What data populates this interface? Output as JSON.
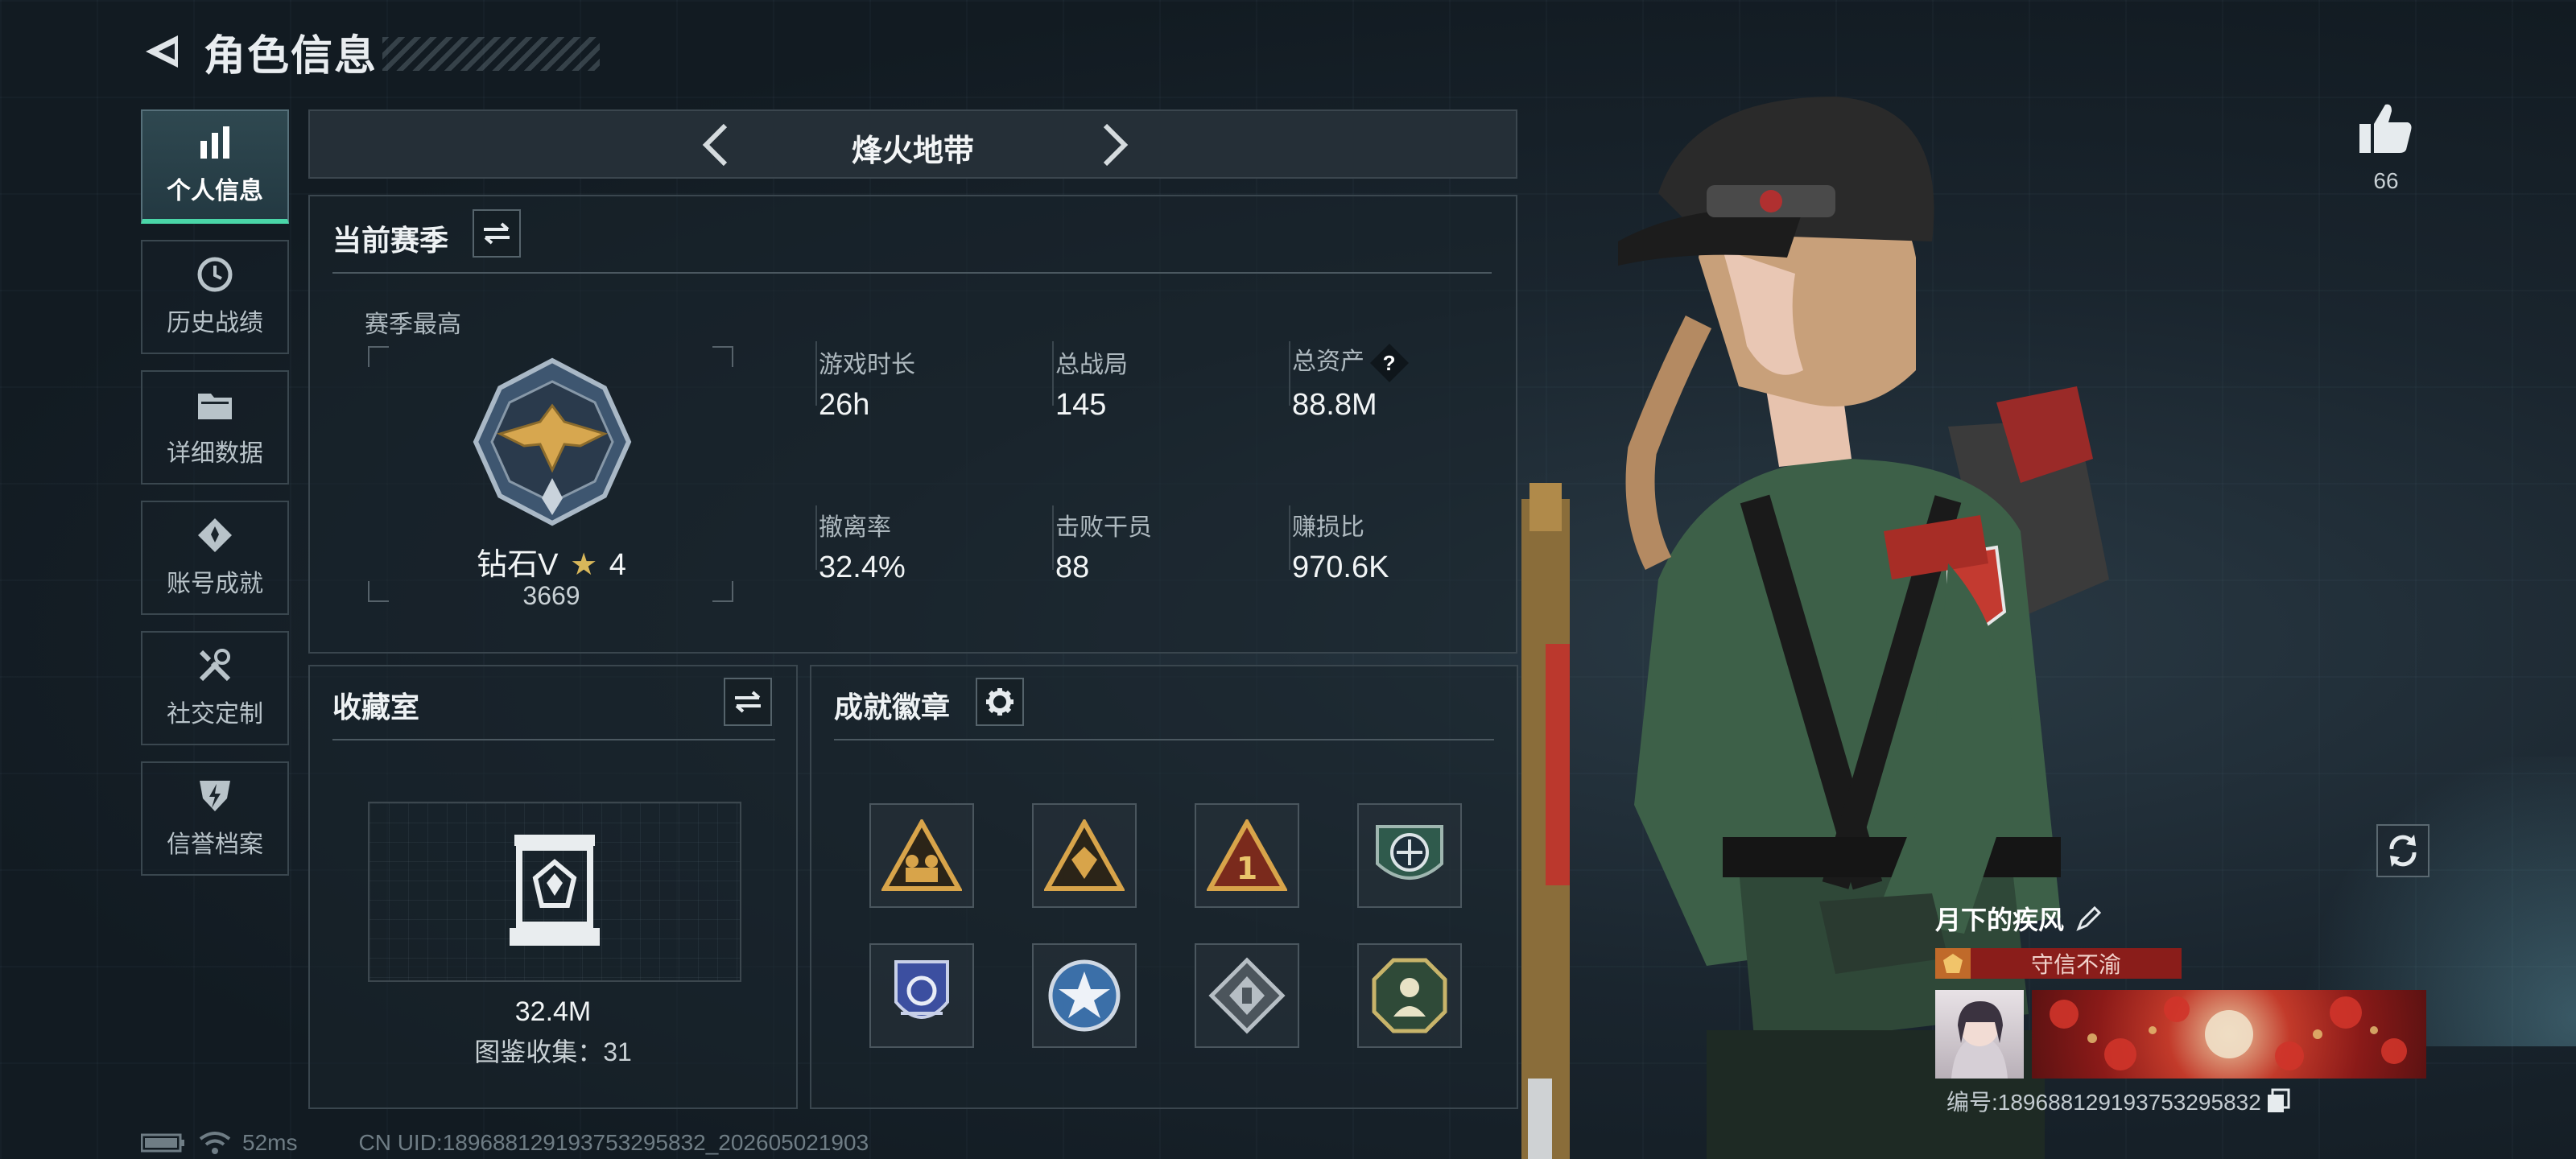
{
  "header": {
    "title": "角色信息"
  },
  "tabs": [
    {
      "label": "个人信息",
      "icon": "bar-chart-icon",
      "active": true
    },
    {
      "label": "历史战绩",
      "icon": "history-icon",
      "active": false
    },
    {
      "label": "详细数据",
      "icon": "folder-icon",
      "active": false
    },
    {
      "label": "账号成就",
      "icon": "achievement-icon",
      "active": false
    },
    {
      "label": "社交定制",
      "icon": "tools-icon",
      "active": false
    },
    {
      "label": "信誉档案",
      "icon": "shield-bolt-icon",
      "active": false
    }
  ],
  "mode": {
    "name": "烽火地带"
  },
  "season": {
    "title": "当前赛季",
    "best_label": "赛季最高",
    "rank_name": "钻石V",
    "rank_stars": "4",
    "rank_score": "3669",
    "stats": [
      {
        "label": "游戏时长",
        "value": "26h"
      },
      {
        "label": "总战局",
        "value": "145"
      },
      {
        "label": "总资产",
        "value": "88.8M",
        "help": "?"
      },
      {
        "label": "撤离率",
        "value": "32.4%"
      },
      {
        "label": "击败干员",
        "value": "88"
      },
      {
        "label": "赚损比",
        "value": "970.6K"
      }
    ]
  },
  "collection": {
    "title": "收藏室",
    "value": "32.4M",
    "codex_label": "图鉴收集：31"
  },
  "badges": {
    "title": "成就徽章",
    "items": [
      {
        "icon": "triangle-soldiers-badge-icon",
        "color": "#d8a44a"
      },
      {
        "icon": "triangle-crest-badge-icon",
        "color": "#d8a44a"
      },
      {
        "icon": "triangle-number-one-badge-icon",
        "color": "#c0452c"
      },
      {
        "icon": "green-circle-emblem-badge-icon",
        "color": "#3a6a5a"
      },
      {
        "icon": "blue-shield-badge-icon",
        "color": "#3c4fa0"
      },
      {
        "icon": "star-circle-badge-icon",
        "color": "#3b6fa8"
      },
      {
        "icon": "silver-diamond-badge-icon",
        "color": "#b6bec4"
      },
      {
        "icon": "green-octagon-badge-icon",
        "color": "#4b7a58"
      }
    ]
  },
  "profile": {
    "likes": "66",
    "name": "月下的疾风",
    "honor_title": "守信不渝",
    "id_text": "编号:18968812919375329583​2"
  },
  "status": {
    "ping": "52ms",
    "uid": "CN UID:18968812919375329583​2_202605021903"
  },
  "colors": {
    "accent": "#4ad6a8",
    "honor": "#8a1d1a"
  }
}
